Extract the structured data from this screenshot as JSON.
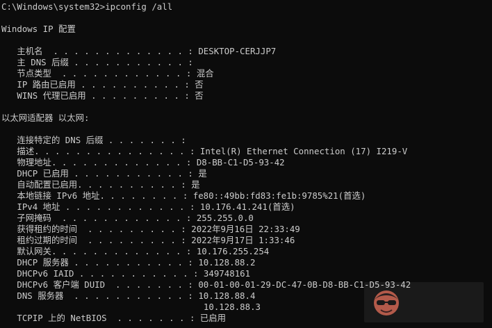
{
  "colors": {
    "background": "#0c0c0c",
    "text": "#cccccc"
  },
  "console": {
    "prompt_line": "C:\\Windows\\system32>ipconfig /all",
    "header": "Windows IP 配置",
    "global_rows": [
      "   主机名  . . . . . . . . . . . . . : DESKTOP-CERJJP7",
      "   主 DNS 后缀 . . . . . . . . . . . :",
      "   节点类型  . . . . . . . . . . . . : 混合",
      "   IP 路由已启用 . . . . . . . . . . : 否",
      "   WINS 代理已启用 . . . . . . . . . : 否"
    ],
    "adapter_header": "以太网适配器 以太网:",
    "adapter_rows": [
      "   连接特定的 DNS 后缀 . . . . . . . :",
      "   描述. . . . . . . . . . . . . . . : Intel(R) Ethernet Connection (17) I219-V",
      "   物理地址. . . . . . . . . . . . . : D8-BB-C1-D5-93-42",
      "   DHCP 已启用 . . . . . . . . . . . : 是",
      "   自动配置已启用. . . . . . . . . . : 是",
      "   本地链接 IPv6 地址. . . . . . . . : fe80::49bb:fd83:fe1b:9785%21(首选)",
      "   IPv4 地址 . . . . . . . . . . . . : 10.176.41.241(首选)",
      "   子网掩码  . . . . . . . . . . . . : 255.255.0.0",
      "   获得租约的时间  . . . . . . . . . : 2022年9月16日 22:33:49",
      "   租约过期的时间  . . . . . . . . . : 2022年9月17日 1:33:46",
      "   默认网关. . . . . . . . . . . . . : 10.176.255.254",
      "   DHCP 服务器 . . . . . . . . . . . : 10.128.88.2",
      "   DHCPv6 IAID . . . . . . . . . . . : 349748161",
      "   DHCPv6 客户端 DUID  . . . . . . . : 00-01-00-01-29-DC-47-0B-D8-BB-C1-D5-93-42",
      "   DNS 服务器  . . . . . . . . . . . : 10.128.88.4",
      "                                       10.128.88.3",
      "   TCPIP 上的 NetBIOS  . . . . . . . : 已启用"
    ]
  },
  "watermark": {
    "icon": "avatar-face-icon"
  }
}
